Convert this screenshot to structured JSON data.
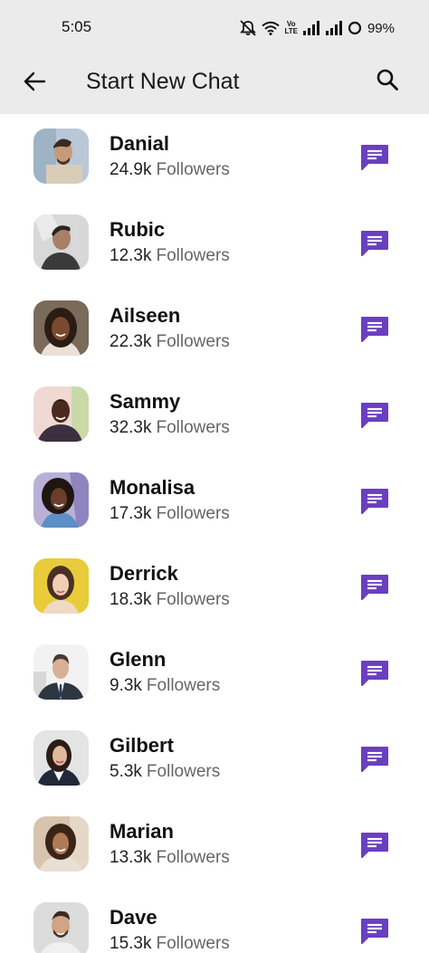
{
  "status_bar": {
    "time": "5:05",
    "volte_top": "Vo",
    "volte_bottom": "LTE",
    "battery": "99%",
    "icons": [
      "mute-bell-icon",
      "wifi-icon",
      "volte-icon",
      "signal-icon",
      "signal-icon",
      "battery-ring-icon"
    ]
  },
  "app_bar": {
    "title": "Start New Chat",
    "back_icon": "arrow-left-icon",
    "search_icon": "search-icon"
  },
  "colors": {
    "accent": "#6a3fc0",
    "header_bg": "#ebebeb",
    "followers_label": "#666666"
  },
  "contacts": [
    {
      "name": "Danial",
      "count": "24.9k",
      "label": "Followers"
    },
    {
      "name": "Rubic",
      "count": "12.3k",
      "label": "Followers"
    },
    {
      "name": "Ailseen",
      "count": "22.3k",
      "label": "Followers"
    },
    {
      "name": "Sammy",
      "count": "32.3k",
      "label": "Followers"
    },
    {
      "name": "Monalisa",
      "count": "17.3k",
      "label": "Followers"
    },
    {
      "name": "Derrick",
      "count": "18.3k",
      "label": "Followers"
    },
    {
      "name": "Glenn",
      "count": "9.3k",
      "label": "Followers"
    },
    {
      "name": "Gilbert",
      "count": "5.3k",
      "label": "Followers"
    },
    {
      "name": "Marian",
      "count": "13.3k",
      "label": "Followers"
    },
    {
      "name": "Dave",
      "count": "15.3k",
      "label": "Followers"
    }
  ]
}
